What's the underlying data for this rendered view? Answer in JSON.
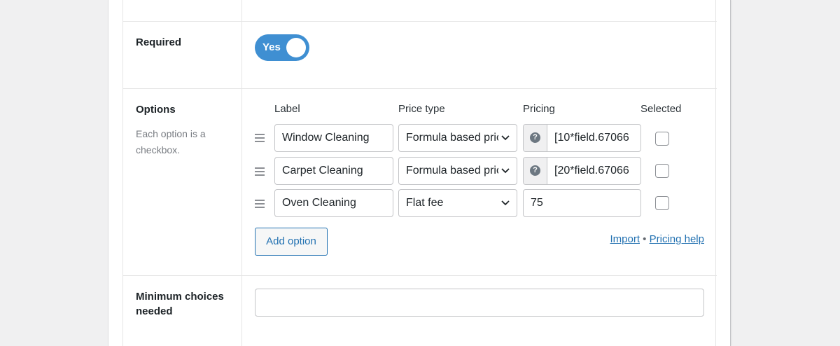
{
  "required": {
    "label": "Required",
    "toggle_label": "Yes",
    "toggle_on": true,
    "toggle_color": "#3f8fd2"
  },
  "options": {
    "label": "Options",
    "description": "Each option is a checkbox.",
    "columns": [
      "Label",
      "Price type",
      "Pricing",
      "Selected"
    ],
    "rows": [
      {
        "label": "Window Cleaning",
        "price_type": "Formula based price",
        "pricing": "[10*field.67066",
        "has_help": true,
        "selected": false
      },
      {
        "label": "Carpet Cleaning",
        "price_type": "Formula based price",
        "pricing": "[20*field.67066",
        "has_help": true,
        "selected": false
      },
      {
        "label": "Oven Cleaning",
        "price_type": "Flat fee",
        "pricing": "75",
        "has_help": false,
        "selected": false
      }
    ],
    "add_button": "Add option",
    "import_link": "Import",
    "separator": "•",
    "pricing_help_link": "Pricing help"
  },
  "minimum": {
    "label": "Minimum choices needed",
    "value": ""
  },
  "icons": {
    "help": "question-mark-icon",
    "drag": "drag-handle-icon",
    "select": "chevron-down-icon"
  },
  "colors": {
    "accent": "#2271b1",
    "border": "#c3c4c7"
  }
}
